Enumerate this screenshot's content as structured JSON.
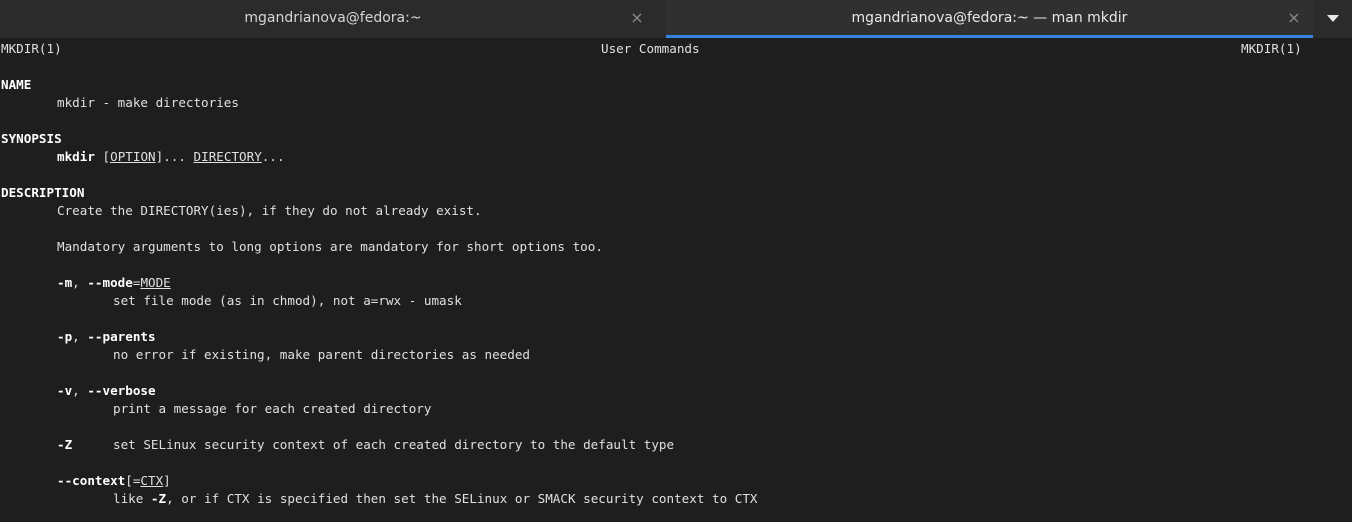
{
  "tabs": [
    {
      "label": "mgandrianova@fedora:~",
      "close_icon": "×",
      "active": false
    },
    {
      "label": "mgandrianova@fedora:~ — man mkdir",
      "close_icon": "×",
      "active": true
    }
  ],
  "colors": {
    "terminal_bg": "#1e1e1e",
    "tabbar_bg": "#2b2b2b",
    "active_tab_accent": "#3584e4",
    "text": "#e0e0e0"
  },
  "man": {
    "header_left": "MKDIR(1)",
    "header_center": "User Commands",
    "header_right": "MKDIR(1)",
    "name_heading": "NAME",
    "name_text": "mkdir - make directories",
    "synopsis_heading": "SYNOPSIS",
    "synopsis_cmd": "mkdir",
    "synopsis_open_bracket": "[",
    "synopsis_option": "OPTION",
    "synopsis_close": "]... ",
    "synopsis_directory": "DIRECTORY",
    "synopsis_ellipsis": "...",
    "description_heading": "DESCRIPTION",
    "desc_line1": "Create the DIRECTORY(ies), if they do not already exist.",
    "desc_line2": "Mandatory arguments to long options are mandatory for short options too.",
    "opt_m_flag": "-m",
    "opt_m_sep": ", ",
    "opt_m_long": "--mode",
    "opt_m_eq": "=",
    "opt_m_arg": "MODE",
    "opt_m_desc": "set file mode (as in chmod), not a=rwx - umask",
    "opt_p_flag": "-p",
    "opt_p_sep": ", ",
    "opt_p_long": "--parents",
    "opt_p_desc": "no error if existing, make parent directories as needed",
    "opt_v_flag": "-v",
    "opt_v_sep": ", ",
    "opt_v_long": "--verbose",
    "opt_v_desc": "print a message for each created directory",
    "opt_z_flag": "-Z",
    "opt_z_desc": "set SELinux security context of each created directory to the default type",
    "opt_context_long": "--context",
    "opt_context_open": "[=",
    "opt_context_arg": "CTX",
    "opt_context_close": "]",
    "opt_context_desc_pre": "like ",
    "opt_context_desc_flag": "-Z",
    "opt_context_desc_post": ", or if CTX is specified then set the SELinux or SMACK security context to CTX"
  }
}
